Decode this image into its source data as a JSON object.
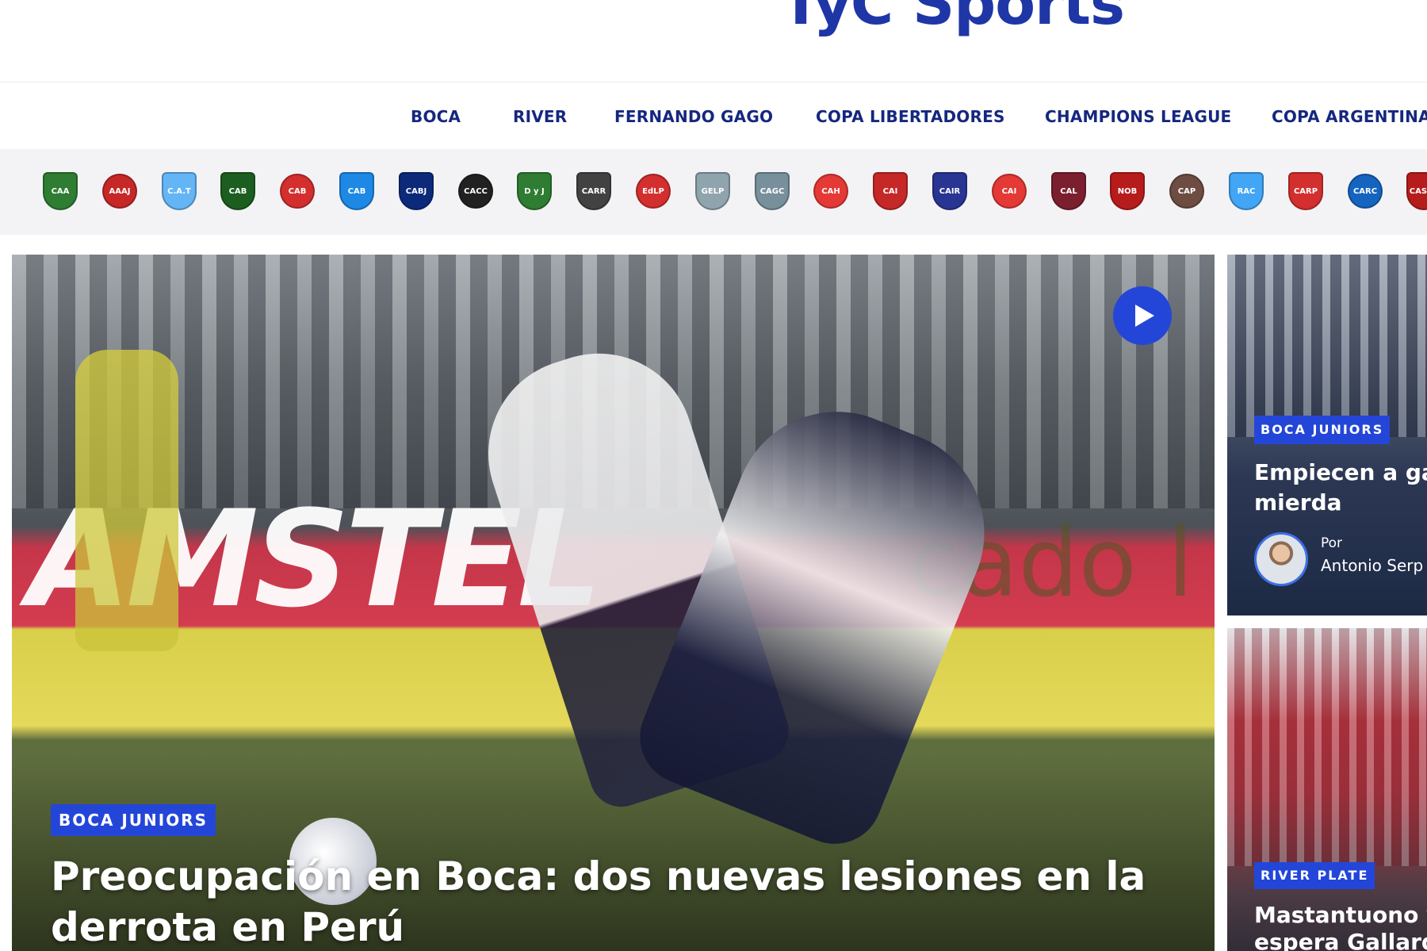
{
  "brand": {
    "logo_text": "TyC Sports",
    "accent_color": "#2446d8",
    "nav_color": "#15277f"
  },
  "nav": {
    "items": [
      {
        "label": "BOCA"
      },
      {
        "label": "RIVER"
      },
      {
        "label": "FERNANDO GAGO"
      },
      {
        "label": "COPA LIBERTADORES"
      },
      {
        "label": "CHAMPIONS LEAGUE"
      },
      {
        "label": "COPA ARGENTINA"
      }
    ]
  },
  "teams": [
    {
      "abbr": "CAA",
      "color": "#2e7d32"
    },
    {
      "abbr": "AAAJ",
      "color": "#c62828"
    },
    {
      "abbr": "C.A.T",
      "color": "#64b5f6"
    },
    {
      "abbr": "CAB",
      "color": "#1b5e20"
    },
    {
      "abbr": "CAB",
      "color": "#d32f2f"
    },
    {
      "abbr": "CAB",
      "color": "#1e88e5"
    },
    {
      "abbr": "CABJ",
      "color": "#0d2a7a"
    },
    {
      "abbr": "CACC",
      "color": "#212121"
    },
    {
      "abbr": "D y J",
      "color": "#2e7d32"
    },
    {
      "abbr": "CARR",
      "color": "#424242"
    },
    {
      "abbr": "EdLP",
      "color": "#d32f2f"
    },
    {
      "abbr": "GELP",
      "color": "#90a4ae"
    },
    {
      "abbr": "CAGC",
      "color": "#78909c"
    },
    {
      "abbr": "CAH",
      "color": "#e53935"
    },
    {
      "abbr": "CAI",
      "color": "#c62828"
    },
    {
      "abbr": "CAIR",
      "color": "#283593"
    },
    {
      "abbr": "CAI",
      "color": "#e53935"
    },
    {
      "abbr": "CAL",
      "color": "#7b1f2f"
    },
    {
      "abbr": "NOB",
      "color": "#b71c1c"
    },
    {
      "abbr": "CAP",
      "color": "#6d4c41"
    },
    {
      "abbr": "RAC",
      "color": "#42a5f5"
    },
    {
      "abbr": "CARP",
      "color": "#d32f2f"
    },
    {
      "abbr": "CARC",
      "color": "#1565c0"
    },
    {
      "abbr": "CASLA",
      "color": "#b71c1c"
    }
  ],
  "main_story": {
    "tag": "BOCA JUNIORS",
    "headline": "Preocupación en Boca: dos nuevas lesiones en la derrota en Perú",
    "sponsor_board": "AMSTEL",
    "sponsor_board_2": "cado l",
    "play_icon": "play-icon"
  },
  "side_stories": [
    {
      "tag": "BOCA JUNIORS",
      "title": "Empiecen a ga mierda",
      "byline_prefix": "Por",
      "author": "Antonio Serp"
    },
    {
      "tag": "RIVER PLATE",
      "title": "Mastantuono y espera Gallardo"
    }
  ]
}
